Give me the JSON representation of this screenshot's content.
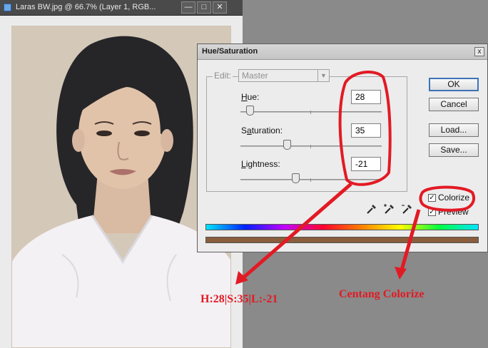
{
  "document_window": {
    "title": "Laras BW.jpg @ 66.7% (Layer 1, RGB...",
    "buttons": {
      "minimize": "—",
      "restore": "□",
      "close": "✕"
    }
  },
  "dialog": {
    "title": "Hue/Saturation",
    "close_label": "x",
    "edit": {
      "label": "Edit:",
      "value": "Master"
    },
    "fields": [
      {
        "label_key": "H",
        "label_rest": "ue:",
        "value": "28",
        "slider_percent": 8
      },
      {
        "label_pre": "S",
        "label_key": "a",
        "label_rest": "turation:",
        "value": "35",
        "slider_percent": 33.5
      },
      {
        "label_key": "L",
        "label_rest": "ightness:",
        "value": "-21",
        "slider_percent": 39.5
      }
    ],
    "buttons": {
      "ok": "OK",
      "cancel": "Cancel",
      "load": "Load...",
      "save": "Save..."
    },
    "eyedroppers": [
      "eyedropper-icon",
      "eyedropper-plus-icon",
      "eyedropper-minus-icon"
    ],
    "colorize": {
      "label": "Colorize",
      "checked": true
    },
    "preview": {
      "label": "Preview",
      "checked": true
    },
    "bars": {
      "colorize_result": "#8a5d3c"
    }
  },
  "annotations": {
    "values_note": "H:28|S:35|L:-21",
    "colorize_note": "Centang Colorize",
    "color": "#e21a24"
  }
}
